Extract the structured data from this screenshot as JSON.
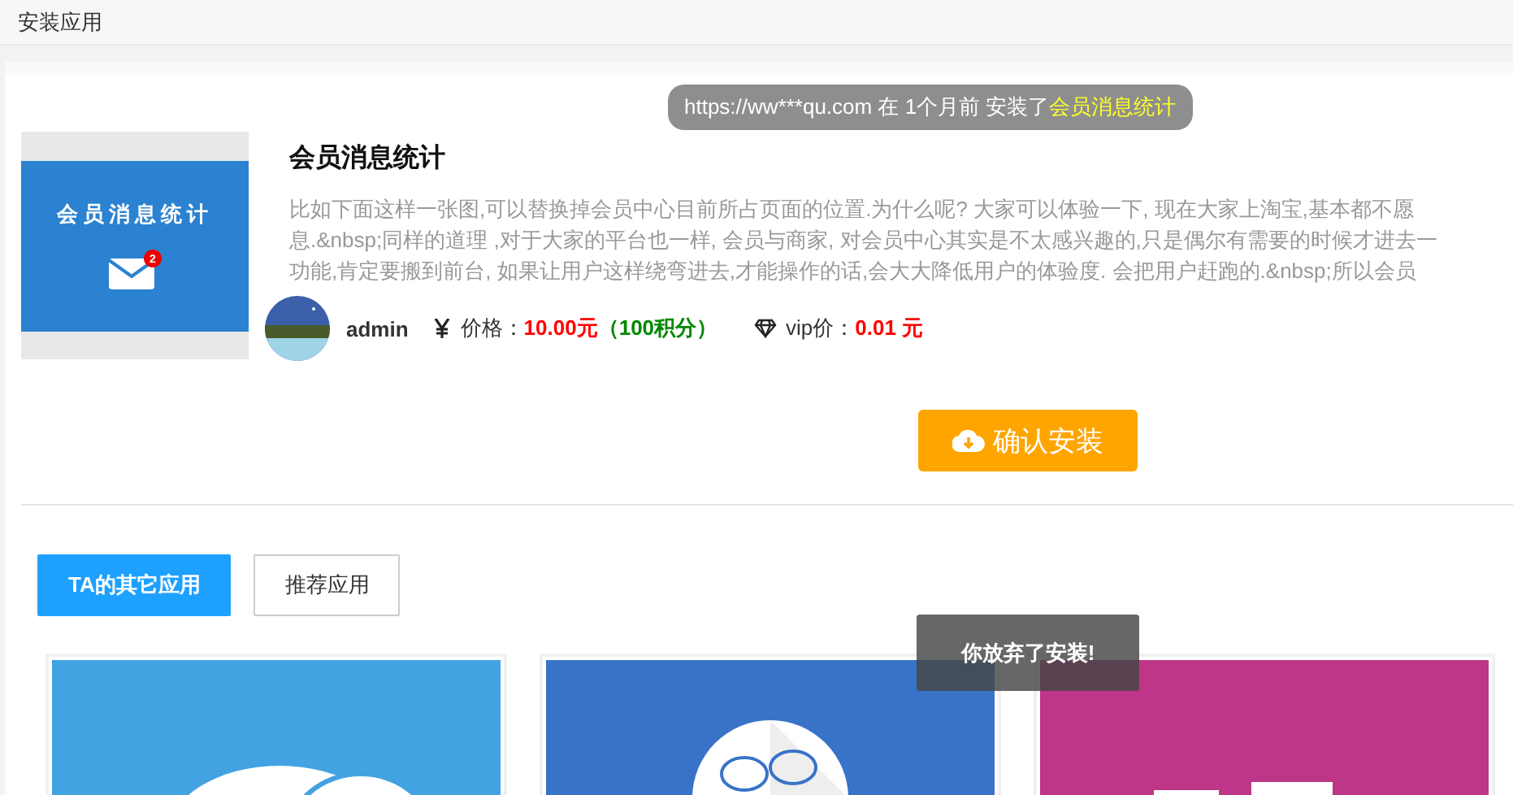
{
  "header": {
    "title": "安装应用"
  },
  "notice": {
    "text": "https://ww***qu.com 在 1个月前 安装了",
    "app": "会员消息统计"
  },
  "app": {
    "thumbnail": {
      "title": "会员消息统计",
      "badge": "2"
    },
    "title": "会员消息统计",
    "description": [
      "比如下面这样一张图,可以替换掉会员中心目前所占页面的位置.为什么呢? 大家可以体验一下, 现在大家上淘宝,基本都不愿",
      "息.&nbsp;同样的道理 ,对于大家的平台也一样, 会员与商家, 对会员中心其实是不太感兴趣的,只是偶尔有需要的时候才进去一",
      "功能,肯定要搬到前台, 如果让用户这样绕弯进去,才能操作的话,会大大降低用户的体验度. 会把用户赶跑的.&nbsp;所以会员"
    ],
    "author": "admin",
    "price_label": "价格：",
    "price": "10.00元",
    "points": "（100积分）",
    "vip_label": "vip价：",
    "vip_price": "0.01 元"
  },
  "install_button": "确认安装",
  "tabs": [
    {
      "label": "TA的其它应用",
      "selected": true
    },
    {
      "label": "推荐应用",
      "selected": false
    }
  ],
  "toast": "你放弃了安装!"
}
